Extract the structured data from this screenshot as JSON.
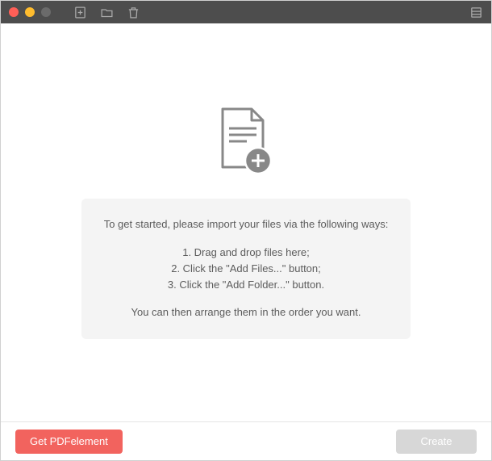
{
  "instructions": {
    "intro": "To get started, please import your files via the following ways:",
    "step1": "1. Drag and drop files here;",
    "step2": "2. Click the \"Add Files...\" button;",
    "step3": "3. Click the \"Add Folder...\" button.",
    "outro": "You can then arrange them in the order you want."
  },
  "footer": {
    "get_label": "Get PDFelement",
    "create_label": "Create"
  }
}
